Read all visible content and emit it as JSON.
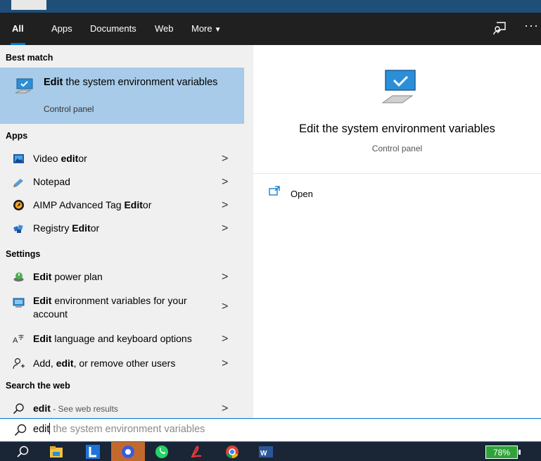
{
  "tabs": [
    {
      "label": "All"
    },
    {
      "label": "Apps"
    },
    {
      "label": "Documents"
    },
    {
      "label": "Web"
    },
    {
      "label": "More"
    }
  ],
  "sections": {
    "best_match": "Best match",
    "apps": "Apps",
    "settings": "Settings",
    "search_web": "Search the web"
  },
  "best_match": {
    "title_bold": "Edit",
    "title_rest": " the system environment variables",
    "subtitle": "Control panel"
  },
  "apps": [
    {
      "pre": "Video ",
      "bold": "edit",
      "post": "or",
      "icon": "video-editor-icon"
    },
    {
      "pre": "Notepad",
      "bold": "",
      "post": "",
      "icon": "notepad-icon"
    },
    {
      "pre": "AIMP Advanced Tag ",
      "bold": "Edit",
      "post": "or",
      "icon": "aimp-icon"
    },
    {
      "pre": "Registry ",
      "bold": "Edit",
      "post": "or",
      "icon": "registry-icon"
    }
  ],
  "settings": [
    {
      "pre": "",
      "bold": "Edit",
      "post": " power plan",
      "icon": "power-plan-icon"
    },
    {
      "pre": "",
      "bold": "Edit",
      "post": " environment variables for your account",
      "icon": "environment-icon"
    },
    {
      "pre": "",
      "bold": "Edit",
      "post": " language and keyboard options",
      "icon": "language-icon"
    },
    {
      "pre": "Add, ",
      "bold": "edit",
      "post": ", or remove other users",
      "icon": "users-icon"
    }
  ],
  "web": {
    "bold": "edit",
    "hint": " - See web results"
  },
  "preview": {
    "title": "Edit the system environment variables",
    "subtitle": "Control panel",
    "open_label": "Open"
  },
  "search": {
    "typed": "edit",
    "ghost": " the system environment variables"
  },
  "taskbar": {
    "battery": "78%"
  },
  "colors": {
    "accent": "#0078d4",
    "selection": "#a7cbe8",
    "tabbar": "#202020"
  }
}
